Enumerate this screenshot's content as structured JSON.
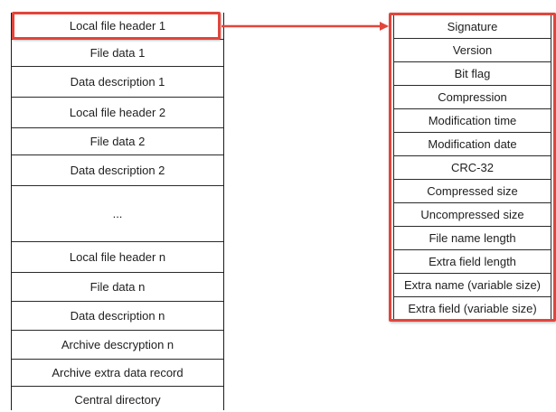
{
  "left_stack": {
    "cells": [
      "Local file header 1",
      "File data 1",
      "Data description 1",
      "Local file header 2",
      "File data 2",
      "Data description 2",
      "...",
      "Local file header n",
      "File data n",
      "Data description n",
      "Archive descryption n",
      "Archive extra data record",
      "Central directory"
    ]
  },
  "right_stack": {
    "cells": [
      "Signature",
      "Version",
      "Bit flag",
      "Compression",
      "Modification time",
      "Modification date",
      "CRC-32",
      "Compressed size",
      "Uncompressed size",
      "File name length",
      "Extra field length",
      "Extra name (variable size)",
      "Extra field (variable size)"
    ]
  },
  "colors": {
    "highlight": "#e2453c",
    "border": "#1c1c1c",
    "text": "#1e1e1e"
  }
}
